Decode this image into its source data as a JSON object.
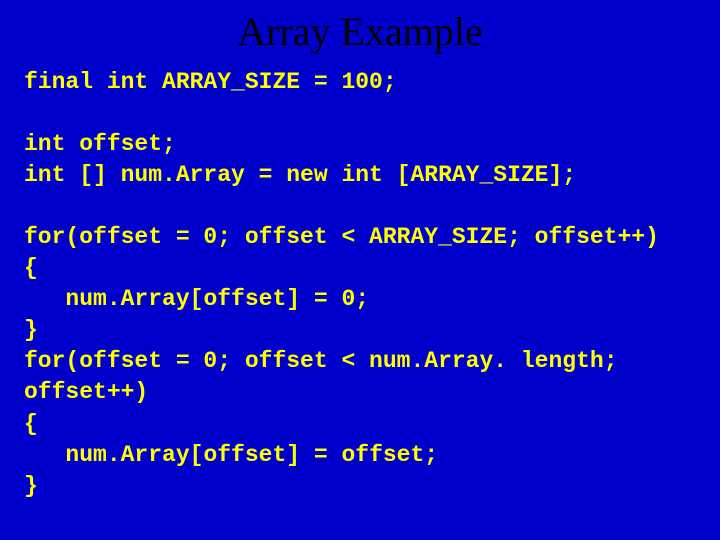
{
  "title": "Array Example",
  "code": "final int ARRAY_SIZE = 100;\n\nint offset;\nint [] num.Array = new int [ARRAY_SIZE];\n\nfor(offset = 0; offset < ARRAY_SIZE; offset++)\n{\n   num.Array[offset] = 0;\n}\nfor(offset = 0; offset < num.Array. length; offset++)\n{\n   num.Array[offset] = offset;\n}"
}
